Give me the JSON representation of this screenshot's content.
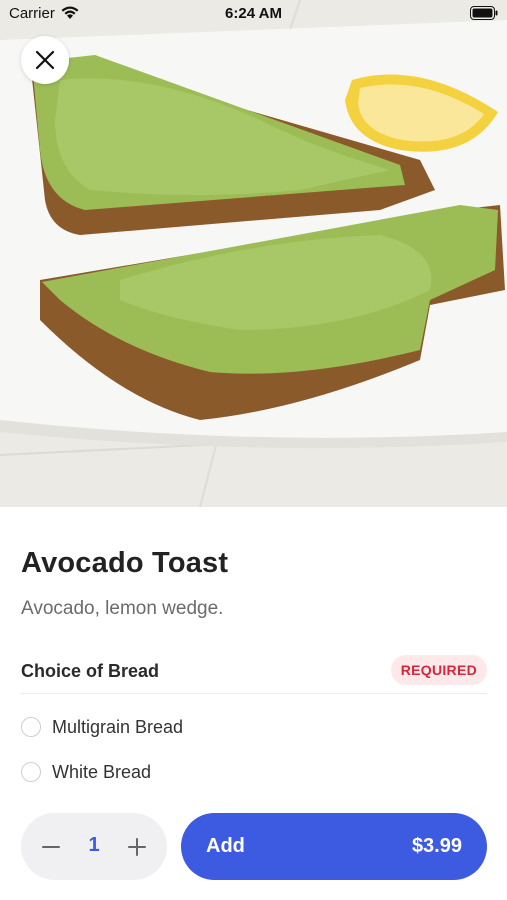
{
  "status_bar": {
    "carrier": "Carrier",
    "time": "6:24 AM",
    "icons": [
      "wifi-icon",
      "battery-icon"
    ]
  },
  "hero": {
    "image": "avocado-toast-photo"
  },
  "close_button": {
    "icon": "close-icon"
  },
  "item": {
    "title": "Avocado Toast",
    "description": "Avocado, lemon wedge."
  },
  "options_section": {
    "title": "Choice of Bread",
    "badge": "REQUIRED",
    "options": [
      {
        "label": "Multigrain Bread",
        "selected": false
      },
      {
        "label": "White Bread",
        "selected": false
      }
    ]
  },
  "footer": {
    "quantity": "1",
    "add_label": "Add",
    "price": "$3.99"
  },
  "colors": {
    "accent": "#3d5be0",
    "badge_bg": "#fde8ea",
    "badge_text": "#d2283a"
  }
}
